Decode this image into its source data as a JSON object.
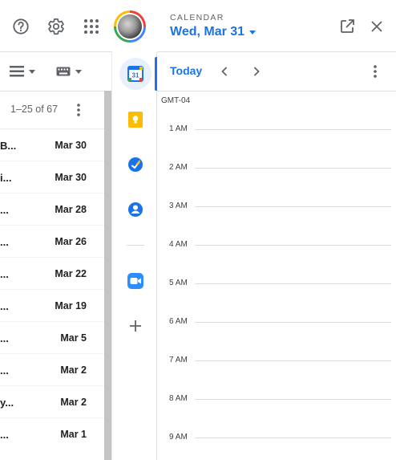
{
  "header": {
    "help_icon": "help-circle-icon",
    "settings_icon": "gear-icon",
    "apps_icon": "apps-grid-icon",
    "avatar": "account-avatar"
  },
  "toolbar": {
    "density_icon": "density-icon",
    "keyboard_icon": "keyboard-icon"
  },
  "pagination": {
    "range_text": "1–25 of 67"
  },
  "mail_list": [
    {
      "subject": "B...",
      "date": "Mar 30"
    },
    {
      "subject": "i...",
      "date": "Mar 30"
    },
    {
      "subject": "...",
      "date": "Mar 28"
    },
    {
      "subject": "...",
      "date": "Mar 26"
    },
    {
      "subject": "...",
      "date": "Mar 22"
    },
    {
      "subject": "...",
      "date": "Mar 19"
    },
    {
      "subject": "...",
      "date": "Mar 5"
    },
    {
      "subject": "...",
      "date": "Mar 2"
    },
    {
      "subject": "y...",
      "date": "Mar 2"
    },
    {
      "subject": "...",
      "date": "Mar 1"
    }
  ],
  "side_panel": {
    "apps": [
      {
        "name": "calendar",
        "icon": "calendar-icon",
        "badge": "31",
        "selected": true
      },
      {
        "name": "keep",
        "icon": "keep-icon"
      },
      {
        "name": "tasks",
        "icon": "tasks-icon"
      },
      {
        "name": "contacts",
        "icon": "contacts-icon"
      },
      {
        "name": "zoom",
        "icon": "zoom-icon"
      }
    ],
    "add_icon": "plus-icon"
  },
  "calendar": {
    "label": "CALENDAR",
    "date": "Wed, Mar 31",
    "today_label": "Today",
    "timezone": "GMT-04",
    "hours": [
      "1 AM",
      "2 AM",
      "3 AM",
      "4 AM",
      "5 AM",
      "6 AM",
      "7 AM",
      "8 AM",
      "9 AM"
    ]
  },
  "colors": {
    "accent": "#1a73e8",
    "text": "#202124",
    "muted": "#5f6368",
    "divider": "#dadce0"
  }
}
